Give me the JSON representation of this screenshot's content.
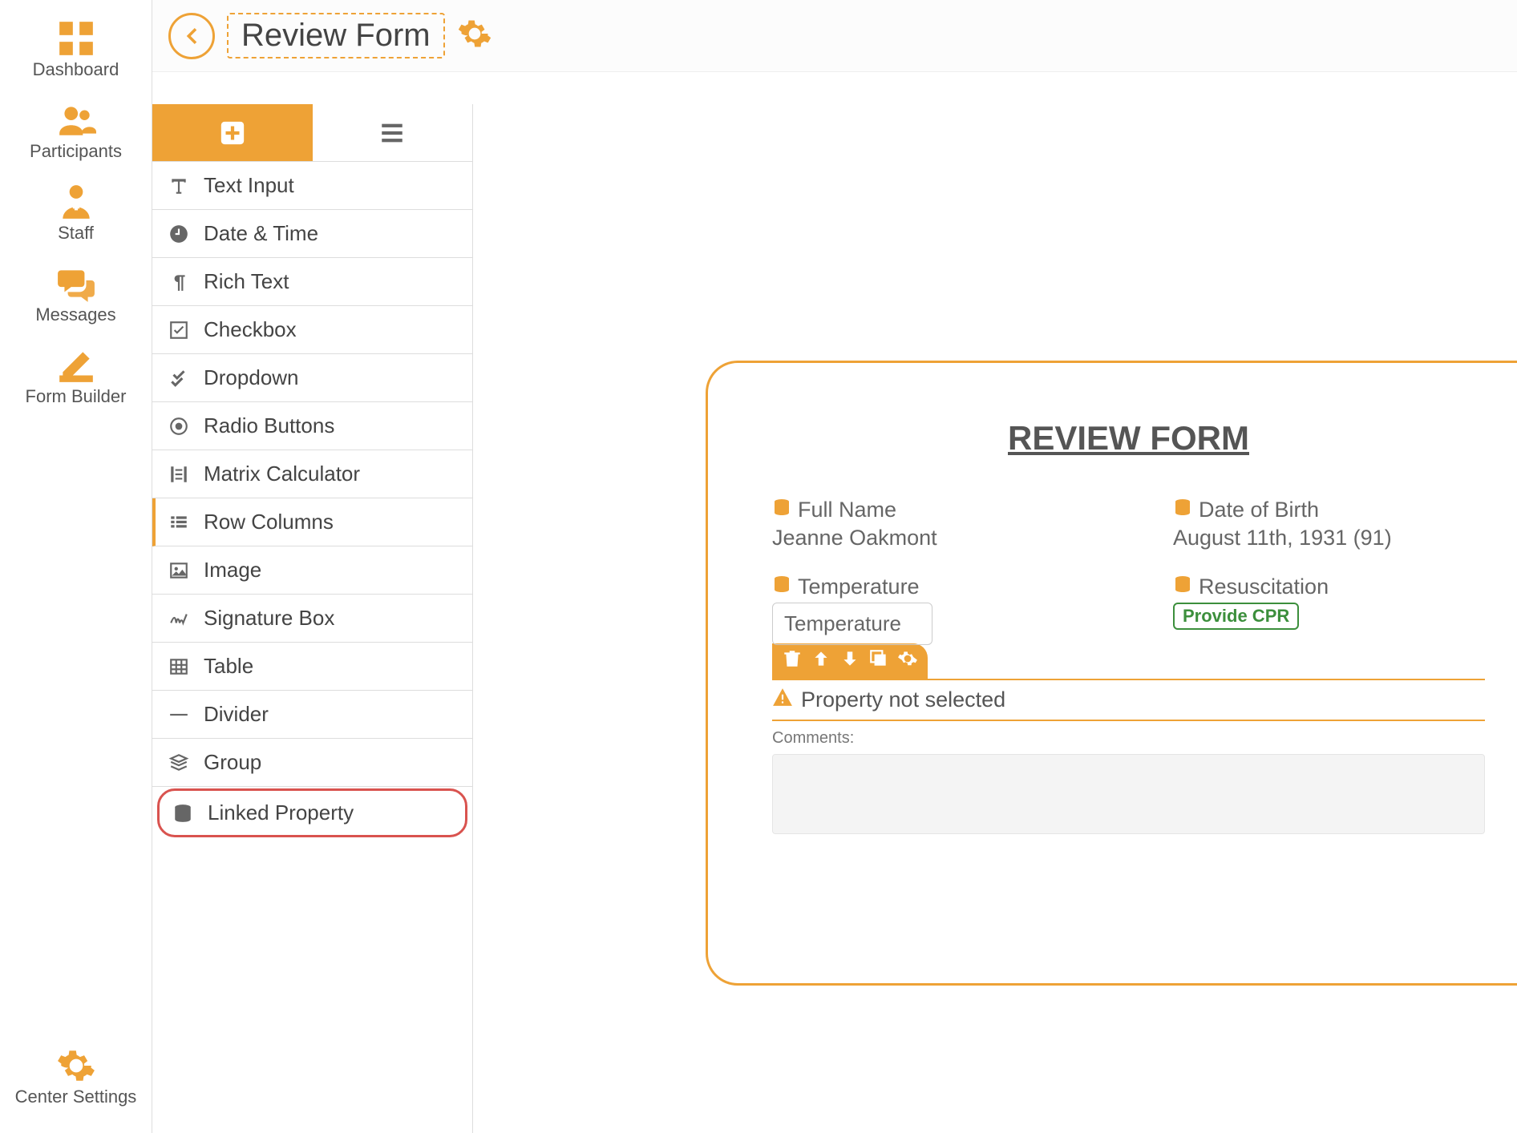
{
  "nav": {
    "items": [
      {
        "label": "Dashboard",
        "icon": "dashboard"
      },
      {
        "label": "Participants",
        "icon": "participants"
      },
      {
        "label": "Staff",
        "icon": "staff"
      },
      {
        "label": "Messages",
        "icon": "messages"
      },
      {
        "label": "Form Builder",
        "icon": "form-builder"
      }
    ],
    "bottom": {
      "label": "Center Settings",
      "icon": "gear"
    }
  },
  "header": {
    "title": "Review Form"
  },
  "elements": [
    {
      "label": "Text Input",
      "icon": "text"
    },
    {
      "label": "Date & Time",
      "icon": "clock"
    },
    {
      "label": "Rich Text",
      "icon": "pilcrow"
    },
    {
      "label": "Checkbox",
      "icon": "checkbox"
    },
    {
      "label": "Dropdown",
      "icon": "dropdown"
    },
    {
      "label": "Radio Buttons",
      "icon": "radio"
    },
    {
      "label": "Matrix Calculator",
      "icon": "matrix"
    },
    {
      "label": "Row Columns",
      "icon": "columns"
    },
    {
      "label": "Image",
      "icon": "image"
    },
    {
      "label": "Signature Box",
      "icon": "signature"
    },
    {
      "label": "Table",
      "icon": "table"
    },
    {
      "label": "Divider",
      "icon": "divider"
    },
    {
      "label": "Group",
      "icon": "group"
    },
    {
      "label": "Linked Property",
      "icon": "database"
    }
  ],
  "form": {
    "title": "REVIEW FORM",
    "fields": {
      "full_name": {
        "label": "Full Name",
        "value": "Jeanne Oakmont"
      },
      "dob": {
        "label": "Date of Birth",
        "value": "August 11th, 1931 (91)"
      },
      "temperature": {
        "label": "Temperature",
        "placeholder": "Temperature"
      },
      "resuscitation": {
        "label": "Resuscitation",
        "badge": "Provide CPR"
      }
    },
    "warning": "Property not selected",
    "comments_label": "Comments:"
  }
}
